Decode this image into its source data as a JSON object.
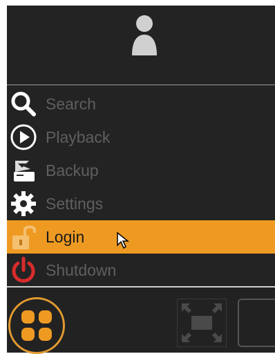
{
  "menu": {
    "items": [
      {
        "label": "Search",
        "icon": "search-icon"
      },
      {
        "label": "Playback",
        "icon": "play-icon"
      },
      {
        "label": "Backup",
        "icon": "backup-icon"
      },
      {
        "label": "Settings",
        "icon": "gear-icon"
      },
      {
        "label": "Login",
        "icon": "unlock-icon",
        "active": true
      },
      {
        "label": "Shutdown",
        "icon": "power-icon"
      }
    ]
  },
  "colors": {
    "panel_bg": "#232323",
    "accent": "#ee9a22",
    "label_inactive": "#5f5f5f",
    "shutdown_red": "#d62c2c"
  }
}
